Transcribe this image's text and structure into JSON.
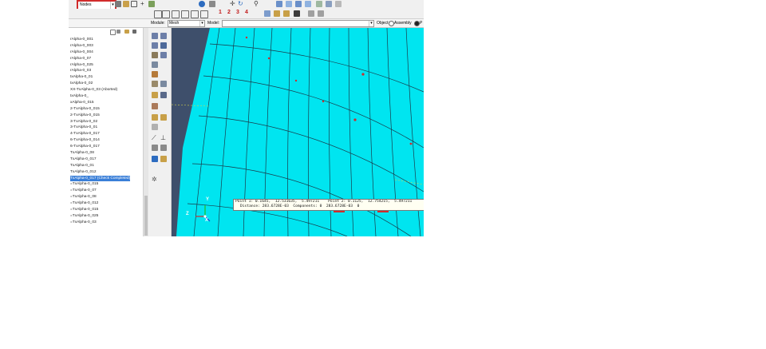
{
  "toolbar": {
    "selection_combo_value": "Nodes",
    "step_numbers": [
      "1",
      "2",
      "3",
      "4"
    ]
  },
  "context_bar": {
    "module_label": "Module:",
    "module_value": "Mesh",
    "model_label": "Model:",
    "model_value": "",
    "object_label": "Object:",
    "assembly_label": "Assembly",
    "part_label": "P"
  },
  "tree": {
    "items": [
      {
        "label": "rAlpha-0_001",
        "selected": false
      },
      {
        "label": "rAlpha-0_003",
        "selected": false
      },
      {
        "label": "rAlpha-0_004",
        "selected": false
      },
      {
        "label": "rAlpha-0_07",
        "selected": false
      },
      {
        "label": "rAlpha-0_025",
        "selected": false
      },
      {
        "label": "rAlpha-0_03",
        "selected": false
      },
      {
        "label": "txAlpha-0_01",
        "selected": false
      },
      {
        "label": "txAlpha-0_02",
        "selected": false
      },
      {
        "label": "XX-TxAlpha-0_03 (Aborted)",
        "selected": false
      },
      {
        "label": "txAlpha-0_",
        "selected": false
      },
      {
        "label": "xAlpha-0_015",
        "selected": false
      },
      {
        "label": "2-TxAlpha-0_015",
        "selected": false
      },
      {
        "label": "2-TxAlpha-0_015",
        "selected": false
      },
      {
        "label": "3-TxAlpha-0_02",
        "selected": false
      },
      {
        "label": "3-TxAlpha-0_01",
        "selected": false
      },
      {
        "label": "4-TxAlpha-0_017",
        "selected": false
      },
      {
        "label": "6-TxAlpha-0_014",
        "selected": false
      },
      {
        "label": "6-TxAlpha-0_017",
        "selected": false
      },
      {
        "label": "TxAlpha-0_08",
        "selected": false
      },
      {
        "label": "TxAlpha-0_017",
        "selected": false
      },
      {
        "label": "TxAlpha-0_01",
        "selected": false
      },
      {
        "label": "TxAlpha-0_012",
        "selected": false
      },
      {
        "label": "TxAlpha-0_017 (Check Completed)",
        "selected": true
      },
      {
        "label": "=TxAlpha-0_015",
        "selected": false
      },
      {
        "label": "=TxAlpha-0_07",
        "selected": false
      },
      {
        "label": "=TxAlpha-0_08",
        "selected": false
      },
      {
        "label": "=TxAlpha-0_012",
        "selected": false
      },
      {
        "label": "=TxAlpha-0_015",
        "selected": false
      },
      {
        "label": "=TxAlpha-0_025",
        "selected": false
      },
      {
        "label": "=TxAlpha-0_03",
        "selected": false
      }
    ]
  },
  "viewport": {
    "readout_line1": "Point 1: 0.1645,  12.531635,  5.497211    Point 2: 0.1125,  12.754215,  5.497211",
    "readout_line2": "Distance: 283.6728E-03  Components: 0  283.6728E-03  0",
    "triad_x": "X",
    "triad_y": "Y",
    "triad_z": "Z"
  },
  "colors": {
    "mesh_fill": "#00e5f0",
    "mesh_line": "#1a3a4a",
    "background": "#3e4f6b",
    "highlight": "#d12b2b",
    "tree_selection": "#3a7fd8"
  }
}
